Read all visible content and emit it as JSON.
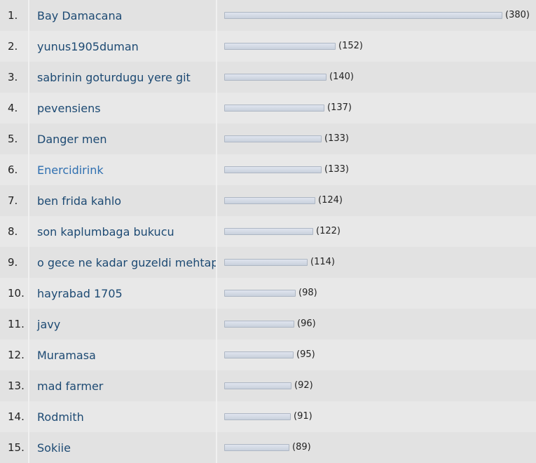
{
  "max_count": 380,
  "entries": [
    {
      "rank": "1.",
      "name": "Bay Damacana",
      "count": 380,
      "count_label": "(380)",
      "highlight": false
    },
    {
      "rank": "2.",
      "name": "yunus1905duman",
      "count": 152,
      "count_label": "(152)",
      "highlight": false
    },
    {
      "rank": "3.",
      "name": "sabrinin goturdugu yere git",
      "count": 140,
      "count_label": "(140)",
      "highlight": false
    },
    {
      "rank": "4.",
      "name": "pevensiens",
      "count": 137,
      "count_label": "(137)",
      "highlight": false
    },
    {
      "rank": "5.",
      "name": "Danger men",
      "count": 133,
      "count_label": "(133)",
      "highlight": false
    },
    {
      "rank": "6.",
      "name": "Enercidirink",
      "count": 133,
      "count_label": "(133)",
      "highlight": true
    },
    {
      "rank": "7.",
      "name": "ben frida kahlo",
      "count": 124,
      "count_label": "(124)",
      "highlight": false
    },
    {
      "rank": "8.",
      "name": "son kaplumbaga bukucu",
      "count": 122,
      "count_label": "(122)",
      "highlight": false
    },
    {
      "rank": "9.",
      "name": "o gece ne kadar guzeldi mehtap",
      "count": 114,
      "count_label": "(114)",
      "highlight": false
    },
    {
      "rank": "10.",
      "name": "hayrabad 1705",
      "count": 98,
      "count_label": "(98)",
      "highlight": false
    },
    {
      "rank": "11.",
      "name": "javy",
      "count": 96,
      "count_label": "(96)",
      "highlight": false
    },
    {
      "rank": "12.",
      "name": "Muramasa",
      "count": 95,
      "count_label": "(95)",
      "highlight": false
    },
    {
      "rank": "13.",
      "name": "mad farmer",
      "count": 92,
      "count_label": "(92)",
      "highlight": false
    },
    {
      "rank": "14.",
      "name": "Rodmith",
      "count": 91,
      "count_label": "(91)",
      "highlight": false
    },
    {
      "rank": "15.",
      "name": "Sokiie",
      "count": 89,
      "count_label": "(89)",
      "highlight": false
    }
  ],
  "colors": {
    "link": "#1d4a73",
    "link_highlight": "#2f6fb0",
    "bar_fill": "#d3d9e4",
    "bar_border": "#aeb7c4"
  }
}
